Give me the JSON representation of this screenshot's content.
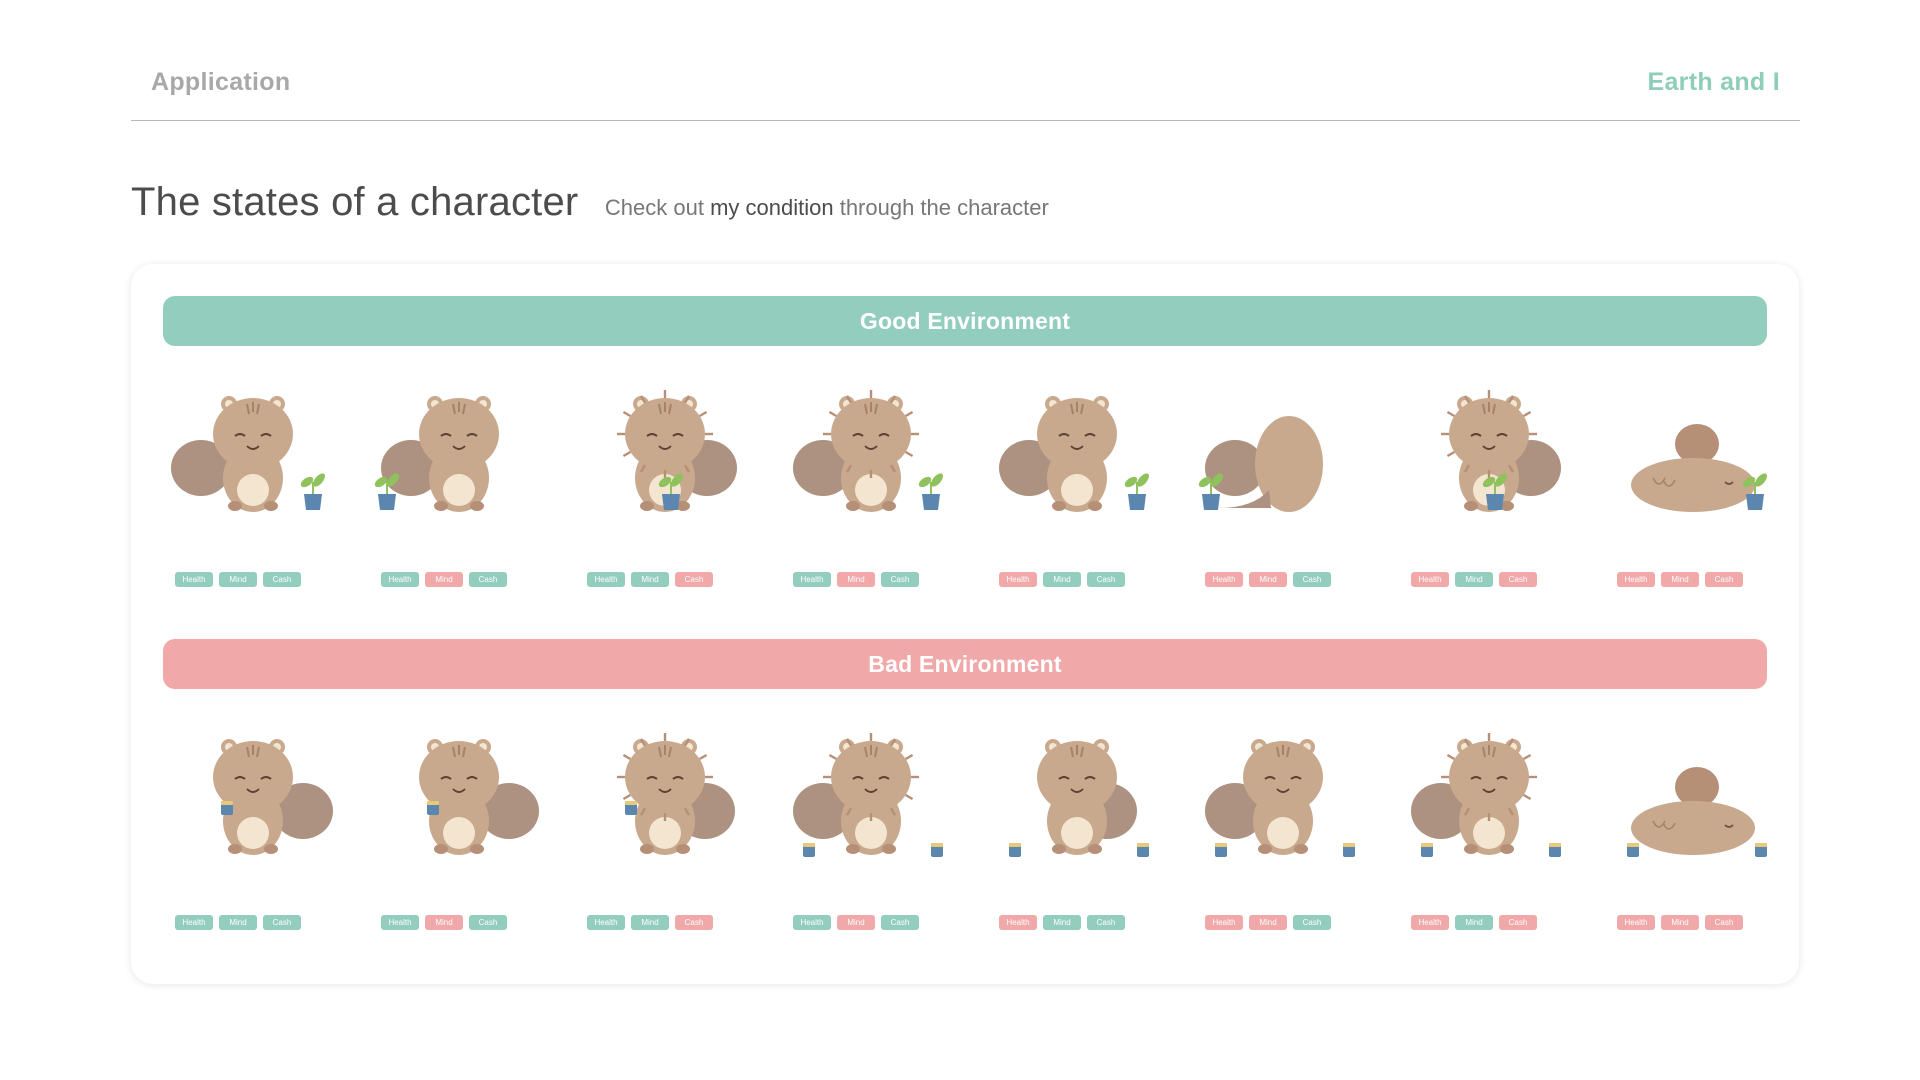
{
  "header": {
    "left_label": "Application",
    "right_label": "Earth and I"
  },
  "section": {
    "title": "The states of a character",
    "subtitle_pre": "Check out ",
    "subtitle_emph": "my condition",
    "subtitle_post": " through the character"
  },
  "colors": {
    "good": "#92cdbd",
    "bad": "#f0a8a8",
    "fur": "#c9a98e",
    "fur_dark": "#b58f76",
    "tail": "#ad9181",
    "belly": "#f3e5cf",
    "pot": "#5b86b0",
    "leaf": "#8fc25d"
  },
  "good_environment": {
    "label": "Good Environment",
    "characters": [
      {
        "pose": "watering-plant",
        "prop": "plant",
        "stats": [
          {
            "label": "Health",
            "state": "good"
          },
          {
            "label": "Mind",
            "state": "good"
          },
          {
            "label": "Cash",
            "state": "good"
          }
        ]
      },
      {
        "pose": "calm",
        "prop": "plant",
        "stats": [
          {
            "label": "Health",
            "state": "good"
          },
          {
            "label": "Mind",
            "state": "bad"
          },
          {
            "label": "Cash",
            "state": "good"
          }
        ]
      },
      {
        "pose": "scruffy-holding-plant",
        "prop": "plant",
        "stats": [
          {
            "label": "Health",
            "state": "good"
          },
          {
            "label": "Mind",
            "state": "good"
          },
          {
            "label": "Cash",
            "state": "bad"
          }
        ]
      },
      {
        "pose": "scruffy-sad",
        "prop": "plant",
        "stats": [
          {
            "label": "Health",
            "state": "good"
          },
          {
            "label": "Mind",
            "state": "bad"
          },
          {
            "label": "Cash",
            "state": "good"
          }
        ]
      },
      {
        "pose": "smiling",
        "prop": "plant",
        "stats": [
          {
            "label": "Health",
            "state": "bad"
          },
          {
            "label": "Mind",
            "state": "good"
          },
          {
            "label": "Cash",
            "state": "good"
          }
        ]
      },
      {
        "pose": "turned-away",
        "prop": "plant",
        "stats": [
          {
            "label": "Health",
            "state": "bad"
          },
          {
            "label": "Mind",
            "state": "bad"
          },
          {
            "label": "Cash",
            "state": "good"
          }
        ]
      },
      {
        "pose": "scruffy-holding-plant",
        "prop": "plant",
        "stats": [
          {
            "label": "Health",
            "state": "bad"
          },
          {
            "label": "Mind",
            "state": "good"
          },
          {
            "label": "Cash",
            "state": "bad"
          }
        ]
      },
      {
        "pose": "lying-down",
        "prop": "plant",
        "stats": [
          {
            "label": "Health",
            "state": "bad"
          },
          {
            "label": "Mind",
            "state": "bad"
          },
          {
            "label": "Cash",
            "state": "bad"
          }
        ]
      }
    ]
  },
  "bad_environment": {
    "label": "Bad Environment",
    "characters": [
      {
        "pose": "holding-can",
        "prop": "can",
        "stats": [
          {
            "label": "Health",
            "state": "good"
          },
          {
            "label": "Mind",
            "state": "good"
          },
          {
            "label": "Cash",
            "state": "good"
          }
        ]
      },
      {
        "pose": "holding-can",
        "prop": "can",
        "stats": [
          {
            "label": "Health",
            "state": "good"
          },
          {
            "label": "Mind",
            "state": "bad"
          },
          {
            "label": "Cash",
            "state": "good"
          }
        ]
      },
      {
        "pose": "scruffy-holding-can",
        "prop": "can",
        "stats": [
          {
            "label": "Health",
            "state": "good"
          },
          {
            "label": "Mind",
            "state": "good"
          },
          {
            "label": "Cash",
            "state": "bad"
          }
        ]
      },
      {
        "pose": "scruffy-sad",
        "prop": "cans",
        "stats": [
          {
            "label": "Health",
            "state": "good"
          },
          {
            "label": "Mind",
            "state": "bad"
          },
          {
            "label": "Cash",
            "state": "good"
          }
        ]
      },
      {
        "pose": "sweating",
        "prop": "cans",
        "stats": [
          {
            "label": "Health",
            "state": "bad"
          },
          {
            "label": "Mind",
            "state": "good"
          },
          {
            "label": "Cash",
            "state": "good"
          }
        ]
      },
      {
        "pose": "tired",
        "prop": "cans",
        "stats": [
          {
            "label": "Health",
            "state": "bad"
          },
          {
            "label": "Mind",
            "state": "bad"
          },
          {
            "label": "Cash",
            "state": "good"
          }
        ]
      },
      {
        "pose": "scruffy-watering",
        "prop": "cans",
        "stats": [
          {
            "label": "Health",
            "state": "bad"
          },
          {
            "label": "Mind",
            "state": "good"
          },
          {
            "label": "Cash",
            "state": "bad"
          }
        ]
      },
      {
        "pose": "lying-down",
        "prop": "cans",
        "stats": [
          {
            "label": "Health",
            "state": "bad"
          },
          {
            "label": "Mind",
            "state": "bad"
          },
          {
            "label": "Cash",
            "state": "bad"
          }
        ]
      }
    ]
  }
}
